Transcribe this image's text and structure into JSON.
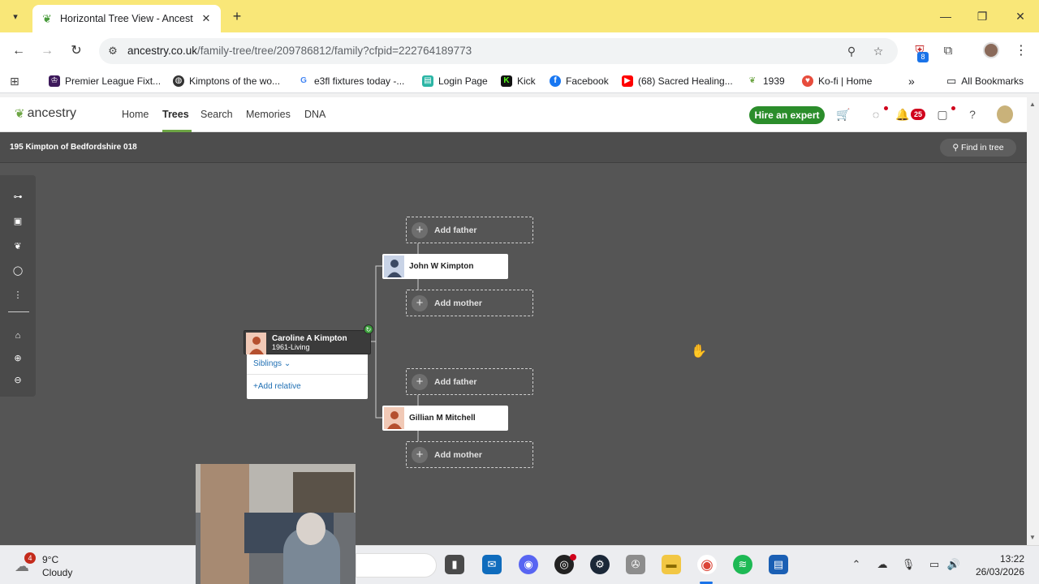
{
  "browser": {
    "tab_title": "Horizontal Tree View - Ancestry",
    "url_domain": "ancestry.co.uk",
    "url_path": "/family-tree/tree/209786812/family?cfpid=222764189773",
    "extension_badge": "8",
    "bookmarks": [
      {
        "label": "Premier League Fixt...",
        "icon": "premier-league-icon",
        "color": "#3d195b"
      },
      {
        "label": "Kimptons of the wo...",
        "icon": "globe-icon",
        "color": "#333333"
      },
      {
        "label": "e3fl fixtures today -...",
        "icon": "google-icon",
        "color": "#4285f4"
      },
      {
        "label": "Login Page",
        "icon": "login-page-icon",
        "color": "#2bb5a5"
      },
      {
        "label": "Kick",
        "icon": "kick-icon",
        "color": "#111111"
      },
      {
        "label": "Facebook",
        "icon": "facebook-icon",
        "color": "#1877f2"
      },
      {
        "label": "(68) Sacred Healing...",
        "icon": "youtube-icon",
        "color": "#ff0000"
      },
      {
        "label": "1939",
        "icon": "ancestry-leaf-icon",
        "color": "#6da544"
      },
      {
        "label": "Ko-fi | Home",
        "icon": "kofi-icon",
        "color": "#e74c3c"
      }
    ],
    "all_bookmarks": "All Bookmarks"
  },
  "header": {
    "logo": "ancestry",
    "nav": [
      "Home",
      "Trees",
      "Search",
      "Memories",
      "DNA"
    ],
    "hire_expert": "Hire an expert",
    "notifications_count": "25"
  },
  "tree": {
    "name": "195 Kimpton of Bedfordshire 018",
    "find_in_tree": "Find in tree",
    "focus_person": {
      "name": "Caroline A Kimpton",
      "dates": "1961-Living"
    },
    "siblings": "Siblings",
    "add_relative": "Add relative",
    "father": {
      "name": "John W Kimpton"
    },
    "mother": {
      "name": "Gillian M Mitchell"
    },
    "add_father": "Add father",
    "add_mother": "Add mother"
  },
  "taskbar": {
    "weather_badge": "4",
    "temperature": "9°C",
    "condition": "Cloudy",
    "time": "13:22",
    "date": "26/03/2026"
  }
}
